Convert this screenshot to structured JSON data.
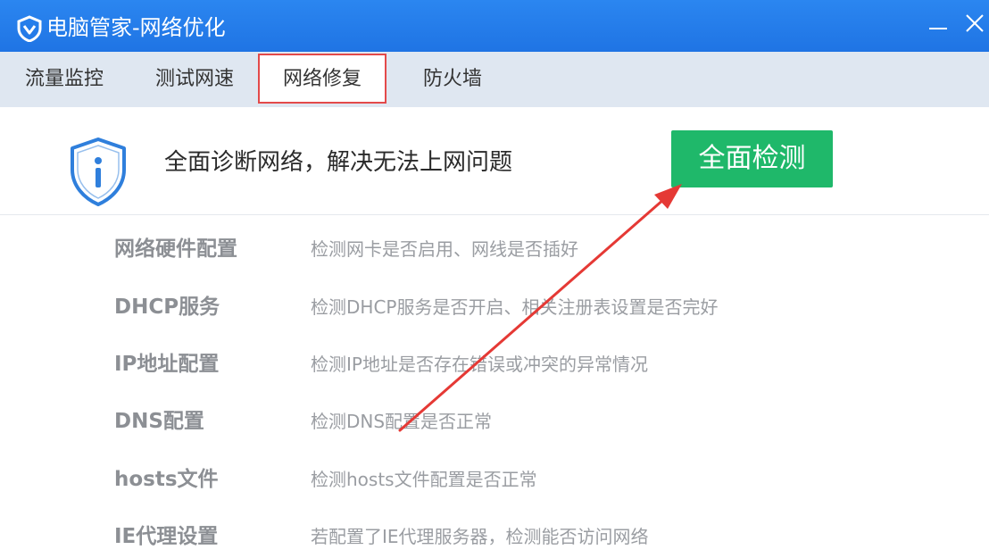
{
  "window": {
    "title": "电脑管家-网络优化",
    "controls": {
      "minimize": "minimize-icon",
      "close": "close-icon"
    }
  },
  "tabs": [
    {
      "label": "流量监控",
      "active": false
    },
    {
      "label": "测试网速",
      "active": false
    },
    {
      "label": "网络修复",
      "active": true
    },
    {
      "label": "防火墙",
      "active": false
    }
  ],
  "header": {
    "icon": "shield-info-icon",
    "text": "全面诊断网络，解决无法上网问题",
    "button_label": "全面检测"
  },
  "checks": [
    {
      "name": "网络硬件配置",
      "desc": "检测网卡是否启用、网线是否插好"
    },
    {
      "name": "DHCP服务",
      "desc": "检测DHCP服务是否开启、相关注册表设置是否完好"
    },
    {
      "name": "IP地址配置",
      "desc": "检测IP地址是否存在错误或冲突的异常情况"
    },
    {
      "name": "DNS配置",
      "desc": "检测DNS配置是否正常"
    },
    {
      "name": "hosts文件",
      "desc": "检测hosts文件配置是否正常"
    },
    {
      "name": "IE代理设置",
      "desc": "若配置了IE代理服务器，检测能否访问网络"
    }
  ],
  "colors": {
    "titlebar": "#1f74e4",
    "tabbar": "#dfe7f1",
    "active_tab_border": "#e34a4a",
    "scan_button": "#1fb86a",
    "annotation_arrow": "#e53935"
  }
}
